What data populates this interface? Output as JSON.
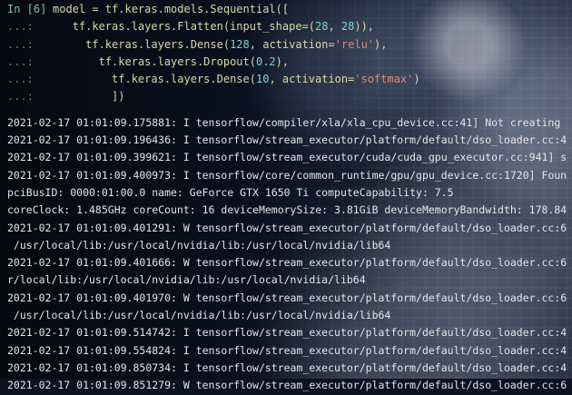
{
  "prompt_label": "In [6]",
  "continuation": "...:",
  "code": {
    "l1": "model = tf.keras.models.Sequential([",
    "l2a": "tf.keras.layers.Flatten(input_shape=(",
    "l2n1": "28",
    "l2b": ", ",
    "l2n2": "28",
    "l2c": ")),",
    "l3a": "tf.keras.layers.Dense(",
    "l3n": "128",
    "l3b": ", activation=",
    "l3s": "'relu'",
    "l3c": "),",
    "l4a": "tf.keras.layers.Dropout(",
    "l4n": "0.2",
    "l4b": "),",
    "l5a": "tf.keras.layers.Dense(",
    "l5n": "10",
    "l5b": ", activation=",
    "l5s": "'softmax'",
    "l5c": ")",
    "l6": "])"
  },
  "output_lines": [
    "2021-02-17 01:01:09.175881: I tensorflow/compiler/xla/xla_cpu_device.cc:41] Not creating",
    "2021-02-17 01:01:09.196436: I tensorflow/stream_executor/platform/default/dso_loader.cc:4",
    "2021-02-17 01:01:09.399621: I tensorflow/stream_executor/cuda/cuda_gpu_executor.cc:941] s",
    "2021-02-17 01:01:09.400973: I tensorflow/core/common_runtime/gpu/gpu_device.cc:1720] Foun",
    "pciBusID: 0000:01:00.0 name: GeForce GTX 1650 Ti computeCapability: 7.5",
    "coreClock: 1.485GHz coreCount: 16 deviceMemorySize: 3.81GiB deviceMemoryBandwidth: 178.84",
    "2021-02-17 01:01:09.401291: W tensorflow/stream_executor/platform/default/dso_loader.cc:6",
    " /usr/local/lib:/usr/local/nvidia/lib:/usr/local/nvidia/lib64",
    "2021-02-17 01:01:09.401666: W tensorflow/stream_executor/platform/default/dso_loader.cc:6",
    "r/local/lib:/usr/local/nvidia/lib:/usr/local/nvidia/lib64",
    "2021-02-17 01:01:09.401970: W tensorflow/stream_executor/platform/default/dso_loader.cc:6",
    " /usr/local/lib:/usr/local/nvidia/lib:/usr/local/nvidia/lib64",
    "2021-02-17 01:01:09.514742: I tensorflow/stream_executor/platform/default/dso_loader.cc:4",
    "2021-02-17 01:01:09.554824: I tensorflow/stream_executor/platform/default/dso_loader.cc:4",
    "2021-02-17 01:01:09.850734: I tensorflow/stream_executor/platform/default/dso_loader.cc:4",
    "2021-02-17 01:01:09.851279: W tensorflow/stream_executor/platform/default/dso_loader.cc:6"
  ]
}
